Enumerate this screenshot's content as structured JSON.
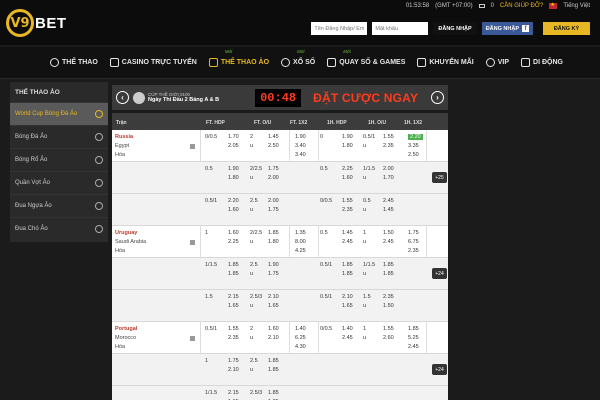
{
  "brand": {
    "v9": "V9",
    "bet": "BET"
  },
  "header": {
    "time": "01:53:58",
    "gmt": "(GMT +07:00)",
    "help": "CẦN GIÚP ĐỠ?",
    "language": "Tiếng Việt",
    "mail_count": "0",
    "username_placeholder": "Tên Đăng Nhập/ Email",
    "password_placeholder": "Mật khẩu",
    "login_label": "ĐĂNG NHẬP",
    "fb_login_label": "ĐĂNG NHẬP",
    "register_label": "ĐĂNG KÝ"
  },
  "nav": [
    {
      "label": "THỂ THAO",
      "new": ""
    },
    {
      "label": "CASINO TRỰC TUYẾN",
      "new": ""
    },
    {
      "label": "THỂ THAO ẢO",
      "new": "Mới"
    },
    {
      "label": "XỔ SỐ",
      "new": "Mới"
    },
    {
      "label": "QUAY SỐ & GAMES",
      "new": "Mới"
    },
    {
      "label": "KHUYẾN MÃI",
      "new": ""
    },
    {
      "label": "VIP",
      "new": ""
    },
    {
      "label": "DI ĐỘNG",
      "new": ""
    }
  ],
  "sidebar": {
    "title": "THỂ THAO ẢO",
    "items": [
      "World Cup Bóng Đá Ảo",
      "Bóng Đá Ảo",
      "Bóng Rổ Ảo",
      "Quần Vợt Ảo",
      "Đua Ngựa Ảo",
      "Đua Chó Ảo"
    ]
  },
  "banner": {
    "line1": "CÚP THẾ GIỚI 0100",
    "line2": "Ngày Thi Đấu 2 Bảng A & B",
    "timer": "00:48",
    "cta": "ĐẶT CƯỢC NGAY"
  },
  "table": {
    "headers": [
      "Trận",
      "FT. HDP",
      "FT. O/U",
      "FT. 1X2",
      "1H. HDP",
      "1H. O/U",
      "1H. 1X2"
    ],
    "matches": [
      {
        "home": "Russia",
        "away": "Egypt",
        "draw": "Hòa",
        "more": "+25",
        "lines": [
          {
            "hdp": "0/0.5",
            "hdp_h": "1.70",
            "hdp_a": "2.05",
            "ou": "2",
            "ou_o": "1.45",
            "ou_u": "u",
            "ou_u_v": "2.50",
            "x12": [
              "1.90",
              "3.40",
              "3.40"
            ],
            "h_hdp": "0",
            "h_hdp_h": "1.90",
            "h_hdp_a": "1.80",
            "h_ou": "0.5/1",
            "h_ou_o": "1.55",
            "h_ou_u": "u",
            "h_ou_u_v": "2.35",
            "h_x12": [
              "2.20",
              "3.35",
              "2.50"
            ]
          },
          {
            "hdp": "0.5",
            "hdp_h": "1.90",
            "hdp_a": "1.80",
            "ou": "2/2.5",
            "ou_o": "1.75",
            "ou_u": "u",
            "ou_u_v": "2.00",
            "x12": [
              "",
              "",
              ""
            ],
            "h_hdp": "0.5",
            "h_hdp_h": "2.25",
            "h_hdp_a": "1.60",
            "h_ou": "1/1.5",
            "h_ou_o": "2.00",
            "h_ou_u": "u",
            "h_ou_u_v": "1.70",
            "h_x12": [
              "",
              "",
              ""
            ]
          },
          {
            "hdp": "0.5/1",
            "hdp_h": "2.20",
            "hdp_a": "1.60",
            "ou": "2.5",
            "ou_o": "2.00",
            "ou_u": "u",
            "ou_u_v": "1.75",
            "x12": [
              "",
              "",
              ""
            ],
            "h_hdp": "0/0.5",
            "h_hdp_h": "1.55",
            "h_hdp_a": "2.35",
            "h_ou": "0.5",
            "h_ou_o": "2.45",
            "h_ou_u": "u",
            "h_ou_u_v": "1.45",
            "h_x12": [
              "",
              "",
              ""
            ]
          }
        ]
      },
      {
        "home": "Uruguay",
        "away": "Saudi Arabia",
        "draw": "Hòa",
        "more": "+24",
        "lines": [
          {
            "hdp": "1",
            "hdp_h": "1.60",
            "hdp_a": "2.25",
            "ou": "2/2.5",
            "ou_o": "1.85",
            "ou_u": "u",
            "ou_u_v": "1.80",
            "x12": [
              "1.35",
              "8.00",
              "4.25"
            ],
            "h_hdp": "0.5",
            "h_hdp_h": "1.45",
            "h_hdp_a": "2.45",
            "h_ou": "1",
            "h_ou_o": "1.50",
            "h_ou_u": "u",
            "h_ou_u_v": "2.45",
            "h_x12": [
              "1.75",
              "6.75",
              "2.35"
            ]
          },
          {
            "hdp": "1/1.5",
            "hdp_h": "1.85",
            "hdp_a": "1.85",
            "ou": "2.5",
            "ou_o": "1.90",
            "ou_u": "u",
            "ou_u_v": "1.75",
            "x12": [
              "",
              "",
              ""
            ],
            "h_hdp": "0.5/1",
            "h_hdp_h": "1.85",
            "h_hdp_a": "1.85",
            "h_ou": "1/1.5",
            "h_ou_o": "1.85",
            "h_ou_u": "u",
            "h_ou_u_v": "1.85",
            "h_x12": [
              "",
              "",
              ""
            ]
          },
          {
            "hdp": "1.5",
            "hdp_h": "2.15",
            "hdp_a": "1.65",
            "ou": "2.5/3",
            "ou_o": "2.10",
            "ou_u": "u",
            "ou_u_v": "1.65",
            "x12": [
              "",
              "",
              ""
            ],
            "h_hdp": "0.5/1",
            "h_hdp_h": "2.10",
            "h_hdp_a": "1.65",
            "h_ou": "1.5",
            "h_ou_o": "2.35",
            "h_ou_u": "u",
            "h_ou_u_v": "1.50",
            "h_x12": [
              "",
              "",
              ""
            ]
          }
        ]
      },
      {
        "home": "Portugal",
        "away": "Morocco",
        "draw": "Hòa",
        "more": "+24",
        "lines": [
          {
            "hdp": "0.5/1",
            "hdp_h": "1.55",
            "hdp_a": "2.35",
            "ou": "2",
            "ou_o": "1.60",
            "ou_u": "u",
            "ou_u_v": "2.10",
            "x12": [
              "1.40",
              "6.25",
              "4.30"
            ],
            "h_hdp": "0/0.5",
            "h_hdp_h": "1.40",
            "h_hdp_a": "2.45",
            "h_ou": "1",
            "h_ou_o": "1.55",
            "h_ou_u": "u",
            "h_ou_u_v": "2.60",
            "h_x12": [
              "1.85",
              "5.25",
              "2.45"
            ]
          },
          {
            "hdp": "1",
            "hdp_h": "1.75",
            "hdp_a": "2.10",
            "ou": "2.5",
            "ou_o": "1.85",
            "ou_u": "u",
            "ou_u_v": "1.85",
            "x12": [
              "",
              "",
              ""
            ],
            "h_hdp": "",
            "h_hdp_h": "",
            "h_hdp_a": "",
            "h_ou": "",
            "h_ou_o": "",
            "h_ou_u": "",
            "h_ou_u_v": "",
            "h_x12": [
              "",
              "",
              ""
            ]
          },
          {
            "hdp": "1/1.5",
            "hdp_h": "2.15",
            "hdp_a": "1.65",
            "ou": "2.5/3",
            "ou_o": "1.85",
            "ou_u": "u",
            "ou_u_v": "1.85",
            "x12": [
              "",
              "",
              ""
            ],
            "h_hdp": "",
            "h_hdp_h": "",
            "h_hdp_a": "",
            "h_ou": "",
            "h_ou_o": "",
            "h_ou_u": "",
            "h_ou_u_v": "",
            "h_x12": [
              "",
              "",
              ""
            ]
          }
        ]
      }
    ]
  }
}
